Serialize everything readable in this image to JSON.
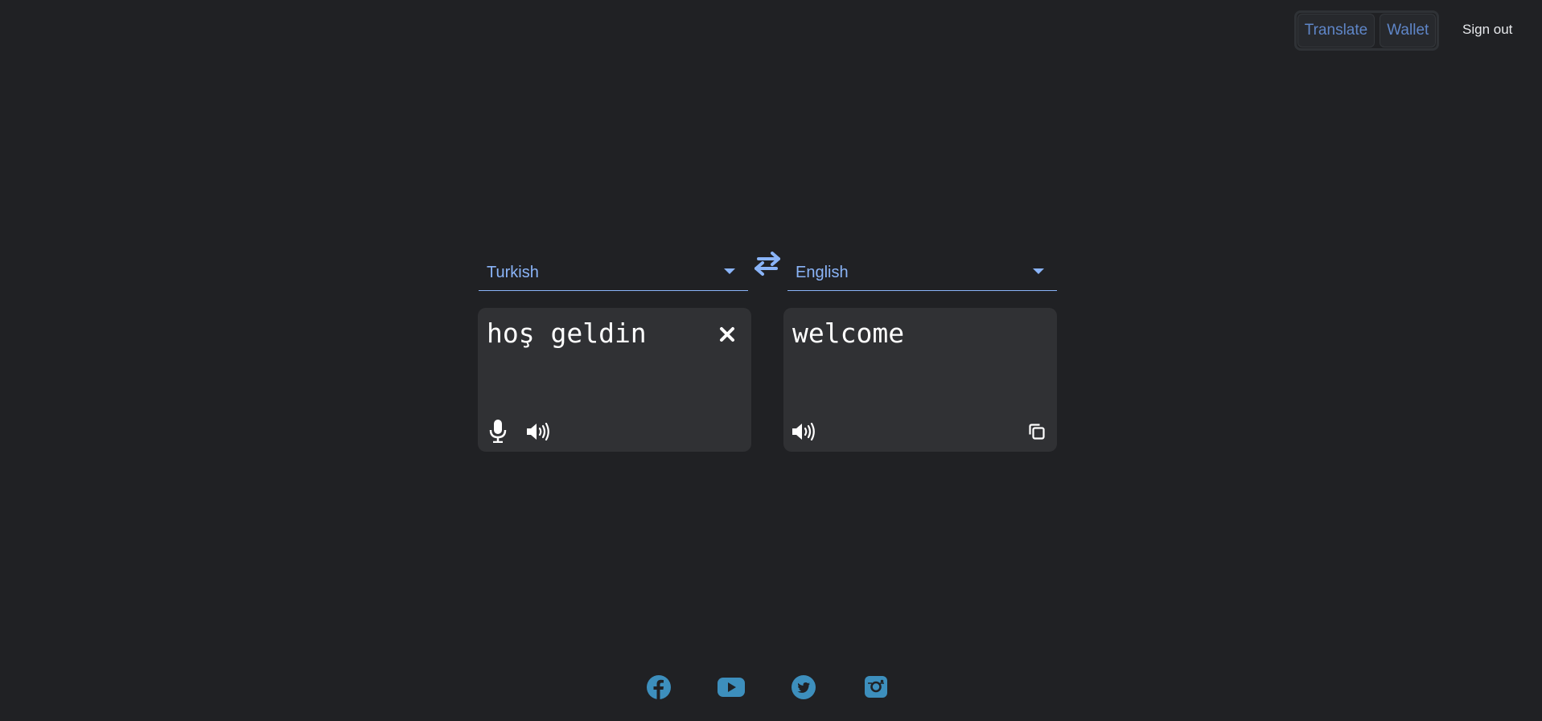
{
  "nav": {
    "translate_label": "Translate",
    "wallet_label": "Wallet",
    "signout_label": "Sign out"
  },
  "translator": {
    "source_language": "Turkish",
    "target_language": "English",
    "source_text": "hoş geldin",
    "target_text": "welcome"
  },
  "footer": {
    "social_icons": [
      "facebook-icon",
      "youtube-icon",
      "twitter-icon",
      "instagram-icon"
    ]
  },
  "colors": {
    "background": "#202124",
    "panel": "#303134",
    "accent": "#8ab4f8",
    "nav_text": "#5f86c8",
    "social": "#3d8fbd"
  }
}
